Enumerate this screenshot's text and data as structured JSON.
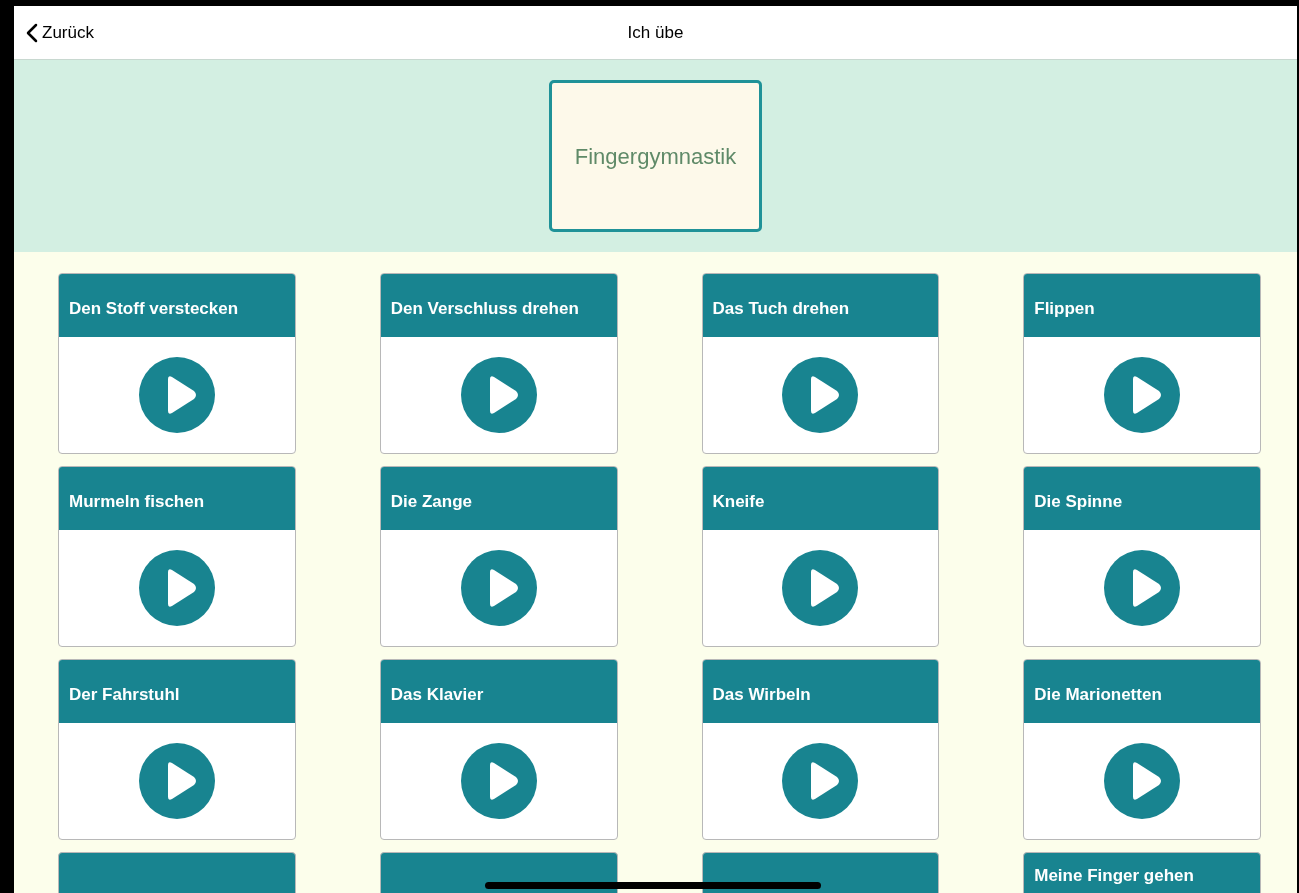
{
  "nav_bar": {
    "back_label": "Zurück",
    "title": "Ich übe"
  },
  "category": {
    "label": "Fingergymnastik"
  },
  "exercises": [
    {
      "kind": "full",
      "title": "Den Stoff verstecken"
    },
    {
      "kind": "full",
      "title": "Den Verschluss drehen"
    },
    {
      "kind": "full",
      "title": "Das Tuch drehen"
    },
    {
      "kind": "full",
      "title": "Flippen"
    },
    {
      "kind": "full",
      "title": "Murmeln fischen"
    },
    {
      "kind": "full",
      "title": "Die Zange"
    },
    {
      "kind": "full",
      "title": "Kneife"
    },
    {
      "kind": "full",
      "title": "Die Spinne"
    },
    {
      "kind": "full",
      "title": "Der Fahrstuhl"
    },
    {
      "kind": "full",
      "title": "Das Klavier"
    },
    {
      "kind": "full",
      "title": "Das Wirbeln"
    },
    {
      "kind": "full",
      "title": "Die Marionetten"
    },
    {
      "kind": "cut"
    },
    {
      "kind": "cut"
    },
    {
      "kind": "cut"
    },
    {
      "kind": "cut",
      "title": "Meine Finger gehen"
    }
  ]
}
